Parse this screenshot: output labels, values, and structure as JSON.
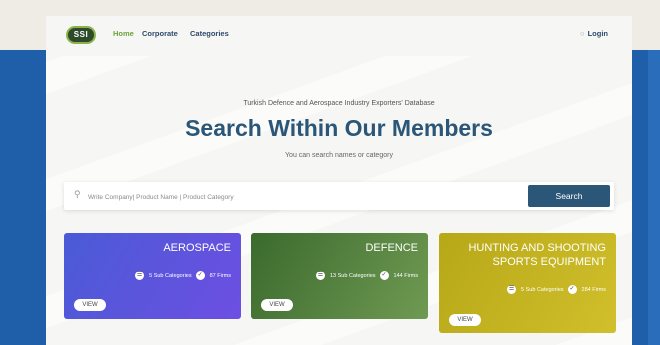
{
  "nav": {
    "logo_text": "SSI",
    "links": [
      "Home",
      "Corporate",
      "Categories"
    ],
    "login": "Login"
  },
  "hero": {
    "subtitle": "Turkish Defence and Aerospace Industry Exporters' Database",
    "title": "Search Within Our Members",
    "hint": "You can search names or category"
  },
  "search": {
    "placeholder": "Write Company| Product Name | Product Category",
    "button": "Search"
  },
  "cards": [
    {
      "title": "AEROSPACE",
      "subcategories": "5 Sub Categories",
      "firms": "87 Firms",
      "view": "VIEW"
    },
    {
      "title": "DEFENCE",
      "subcategories": "13 Sub Categories",
      "firms": "144 Firms",
      "view": "VIEW"
    },
    {
      "title": "HUNTING AND SHOOTING SPORTS EQUIPMENT",
      "subcategories": "5 Sub Categories",
      "firms": "284 Firms",
      "view": "VIEW"
    }
  ],
  "colors": {
    "accent": "#2b5677",
    "home_link": "#6aa33a",
    "background_blue": "#1f5ea8"
  }
}
